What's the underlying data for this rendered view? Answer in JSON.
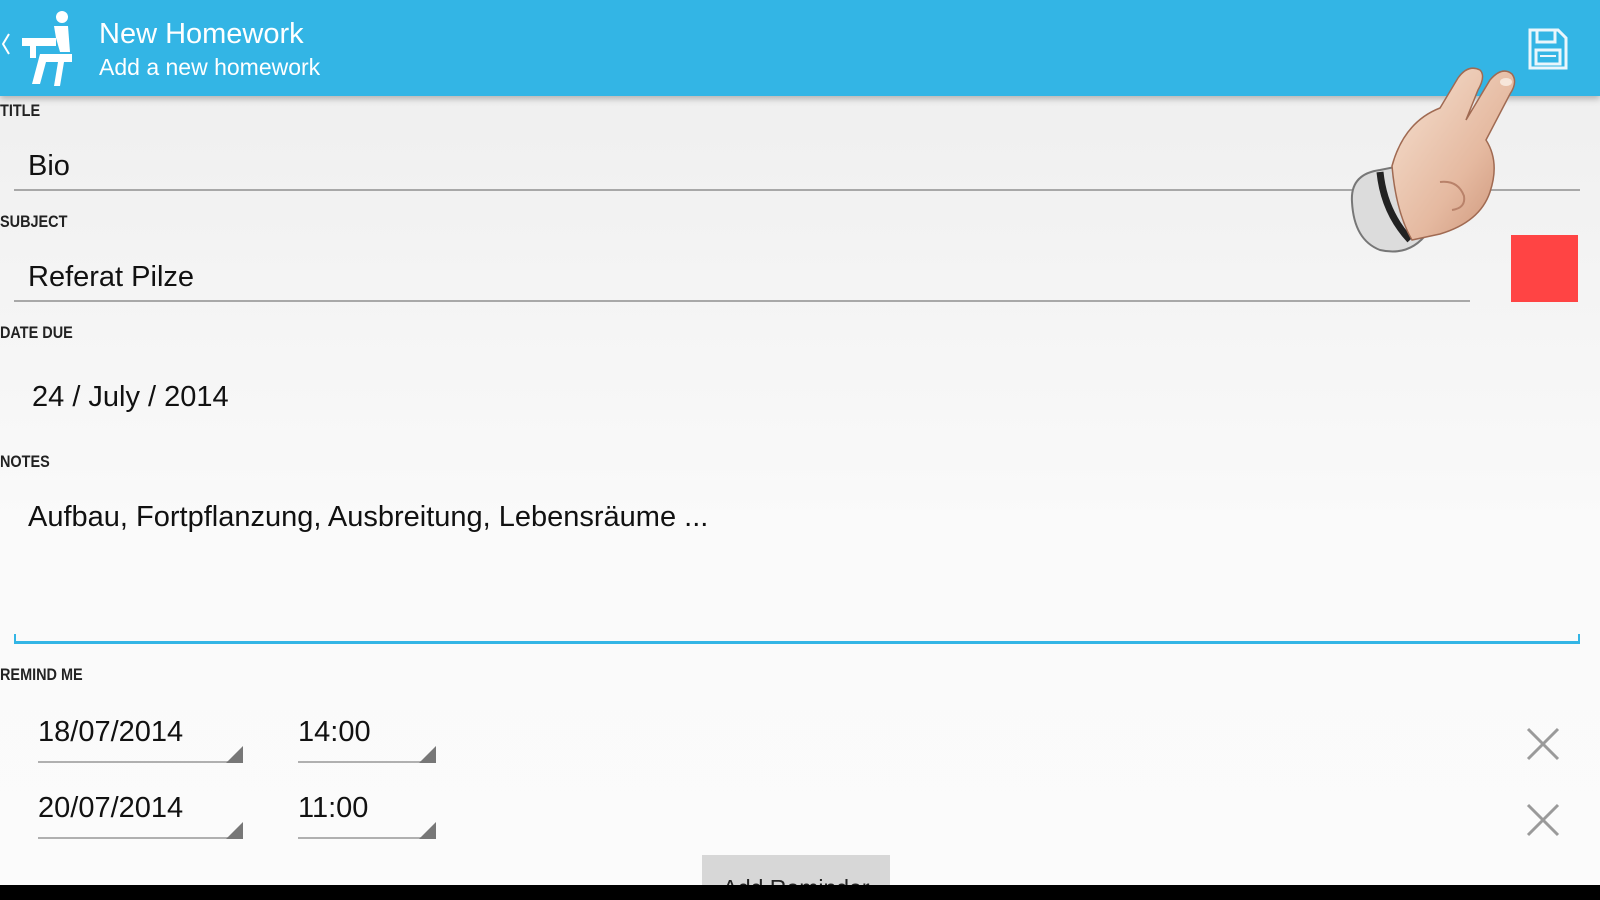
{
  "actionbar": {
    "title": "New Homework",
    "subtitle": "Add a new homework",
    "app_icon": "student-at-desk-icon",
    "save_icon": "floppy-disk-icon",
    "color": "#33b5e5"
  },
  "form": {
    "title_label": "TITLE",
    "title_value": "Bio",
    "subject_label": "SUBJECT",
    "subject_value": "Referat Pilze",
    "subject_color": "#ff4444",
    "date_label": "DATE DUE",
    "date_value": "24 / July / 2014",
    "notes_label": "NOTES",
    "notes_value": "Aufbau, Fortpflanzung, Ausbreitung, Lebensräume ..."
  },
  "reminders": {
    "label": "REMIND ME",
    "items": [
      {
        "date": "18/07/2014",
        "time": "14:00"
      },
      {
        "date": "20/07/2014",
        "time": "11:00"
      }
    ],
    "remove_icon": "close-icon",
    "add_label": "Add Reminder"
  }
}
